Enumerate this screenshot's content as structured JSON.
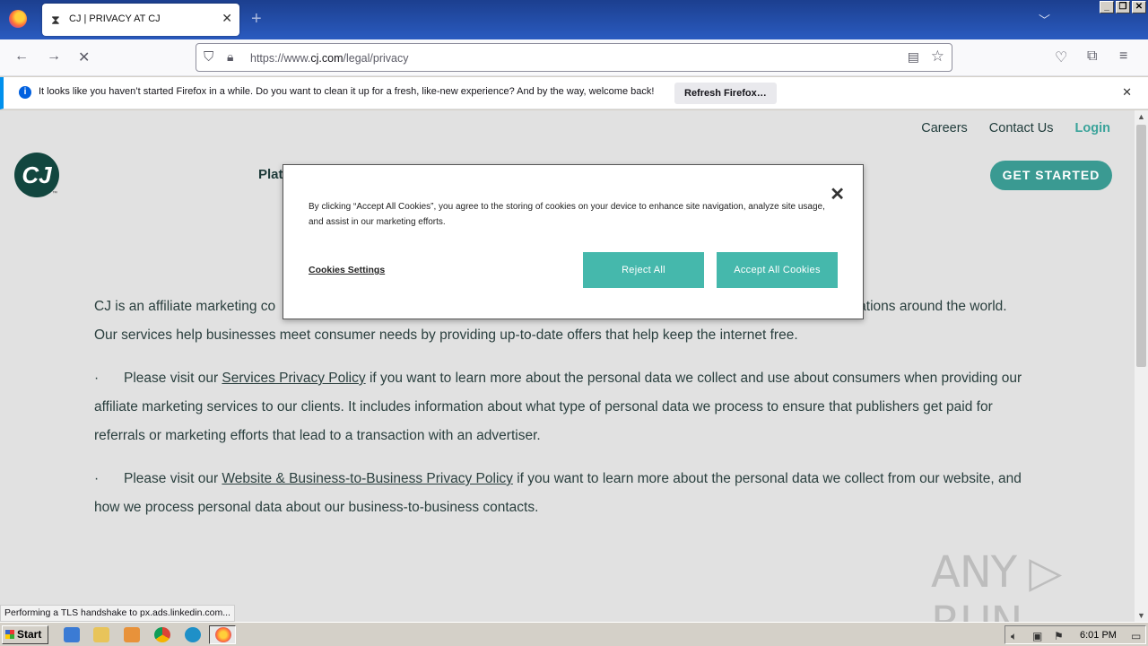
{
  "browser": {
    "tab_title": "CJ | PRIVACY AT CJ",
    "url_prefix": "https://www.",
    "url_domain": "cj.com",
    "url_path": "/legal/privacy",
    "notification": {
      "message": "It looks like you haven’t started Firefox in a while. Do you want to clean it up for a fresh, like-new experience? And by the way, welcome back!",
      "button": "Refresh Firefox…"
    },
    "status_text": "Performing a TLS handshake to px.ads.linkedin.com..."
  },
  "site": {
    "nav": {
      "careers": "Careers",
      "contact": "Contact Us",
      "login": "Login"
    },
    "logo_text": "CJ",
    "logo_tm": "™",
    "platform_partial": "Plat",
    "get_started": "GET STARTED",
    "content": {
      "intro_start": "CJ is an affiliate marketing co",
      "intro_end": "ations around the world.",
      "intro_line2": "Our services help businesses meet consumer needs by providing up-to-date offers that help keep the internet free.",
      "bullet_char": "·",
      "p1_before": "Please visit our ",
      "p1_link": "Services Privacy Policy",
      "p1_after": " if you want to learn more about the personal data we collect and use about consumers when providing our affiliate marketing services to our clients. It includes information about what type of personal data we process to ensure that publishers get paid for referrals or marketing efforts that lead to a transaction with an advertiser.",
      "p2_before": "Please visit our ",
      "p2_link": "Website & Business-to-Business Privacy Policy",
      "p2_after": " if you want to learn more about the personal data we collect from our website, and how we process personal data about our business-to-business contacts."
    }
  },
  "cookie_modal": {
    "text": "By clicking “Accept All Cookies”, you agree to the storing of cookies on your device to enhance site navigation, analyze site usage, and assist in our marketing efforts.",
    "settings": "Cookies Settings",
    "reject": "Reject All",
    "accept": "Accept All Cookies"
  },
  "watermark": "ANY ▷ RUN",
  "taskbar": {
    "start": "Start",
    "clock": "6:01 PM"
  },
  "colors": {
    "accent_teal": "#45b8ac",
    "login_teal": "#3aa39a",
    "logo_dark": "#12463f"
  }
}
